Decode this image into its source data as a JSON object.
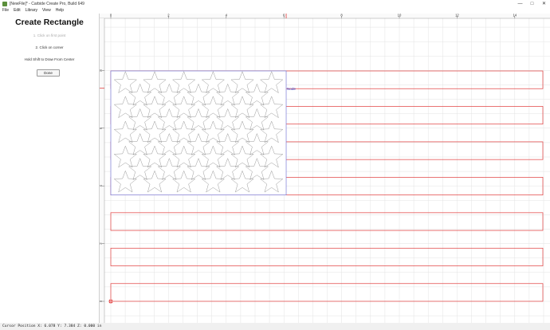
{
  "window": {
    "title": "[NewFile]* - Carbide Create Pro, Build 649",
    "controls": [
      "—",
      "□",
      "✕"
    ]
  },
  "menu": [
    "File",
    "Edit",
    "Library",
    "View",
    "Help"
  ],
  "panel": {
    "title": "Create Rectangle",
    "step1": "1. Click on first point",
    "step2": "2. Click on corner",
    "hint": "Hold Shift to Draw From Center",
    "done_label": "Done"
  },
  "canvas": {
    "x_ticks": [
      "0",
      "2",
      "4",
      "6",
      "8",
      "10",
      "12",
      "14"
    ],
    "y_ticks": [
      "8",
      "6",
      "4",
      "2",
      "0"
    ],
    "annotation": "Node",
    "colors": {
      "grid": "#e3e3e3",
      "stripe": "#e03a3a",
      "canton": "#7a7ad6",
      "star": "#999999",
      "cursor": "#e03a3a"
    }
  },
  "status": {
    "text": "Cursor Position X: 6.078 Y: 7.384 Z: 0.000 in"
  }
}
